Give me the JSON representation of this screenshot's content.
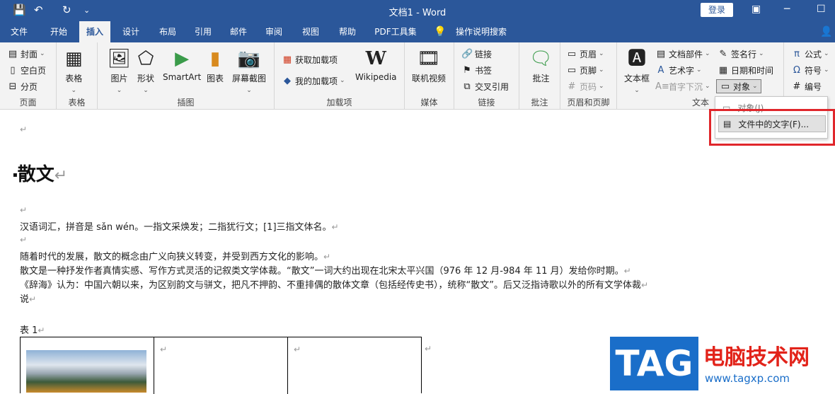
{
  "titlebar": {
    "title": "文档1  -  Word",
    "login": "登录",
    "save_icon": "💾",
    "undo_icon": "↶",
    "redo_icon": "↻",
    "customize_icon": "⌄",
    "restore_icon": "▣",
    "minimize_icon": "─",
    "maximize_icon": "☐"
  },
  "tabs": [
    {
      "label": "文件"
    },
    {
      "label": "开始"
    },
    {
      "label": "插入"
    },
    {
      "label": "设计"
    },
    {
      "label": "布局"
    },
    {
      "label": "引用"
    },
    {
      "label": "邮件"
    },
    {
      "label": "审阅"
    },
    {
      "label": "视图"
    },
    {
      "label": "帮助"
    },
    {
      "label": "PDF工具集"
    },
    {
      "label": "操作说明搜索"
    }
  ],
  "ribbon": {
    "pages": {
      "label": "页面",
      "cover": "封面",
      "blank": "空白页",
      "break": "分页"
    },
    "table": {
      "label": "表格",
      "table": "表格"
    },
    "illustrations": {
      "label": "插图",
      "picture": "图片",
      "shapes": "形状",
      "smartart": "SmartArt",
      "chart": "图表",
      "screenshot": "屏幕截图"
    },
    "addins": {
      "label": "加载项",
      "get": "获取加载项",
      "my": "我的加载项",
      "wiki": "Wikipedia",
      "wiki_icon": "W"
    },
    "media": {
      "label": "媒体",
      "video": "联机视频"
    },
    "links": {
      "label": "链接",
      "link": "链接",
      "bookmark": "书签",
      "cross": "交叉引用"
    },
    "comments": {
      "label": "批注",
      "comment": "批注"
    },
    "header": {
      "label": "页眉和页脚",
      "header": "页眉",
      "footer": "页脚",
      "page": "页码"
    },
    "text": {
      "label": "文本",
      "textbox": "文本框",
      "parts": "文档部件",
      "wordart": "艺术字",
      "dropcap": "首字下沉",
      "sig": "签名行",
      "date": "日期和时间",
      "object": "对象"
    },
    "symbols": {
      "formula": "公式",
      "symbol": "符号",
      "number": "编号"
    }
  },
  "menu": {
    "object": "对象(J)...",
    "text_from_file": "文件中的文字(F)..."
  },
  "doc": {
    "mark": "↵",
    "heading": "散文",
    "p1": "汉语词汇，拼音是 sǎn wén。一指文采焕发；二指犹行文；[1]三指文体名。",
    "p2": "随着时代的发展，散文的概念由广义向狭义转变，并受到西方文化的影响。",
    "p3": "散文是一种抒发作者真情实感、写作方式灵活的记叙类文学体裁。“散文”一词大约出现在北宋太平兴国（976 年 12 月-984 年 11 月）发给你时期。",
    "p4": "《辞海》认为：中国六朝以来，为区别韵文与骈文，把凡不押韵、不重排偶的散体文章（包括经传史书），统称“散文”。后又泛指诗歌以外的所有文学体裁",
    "p5": "说",
    "caption": "表  1"
  },
  "watermark": {
    "tag": "TAG",
    "cn": "电脑技术网",
    "url": "www.tagxp.com"
  }
}
